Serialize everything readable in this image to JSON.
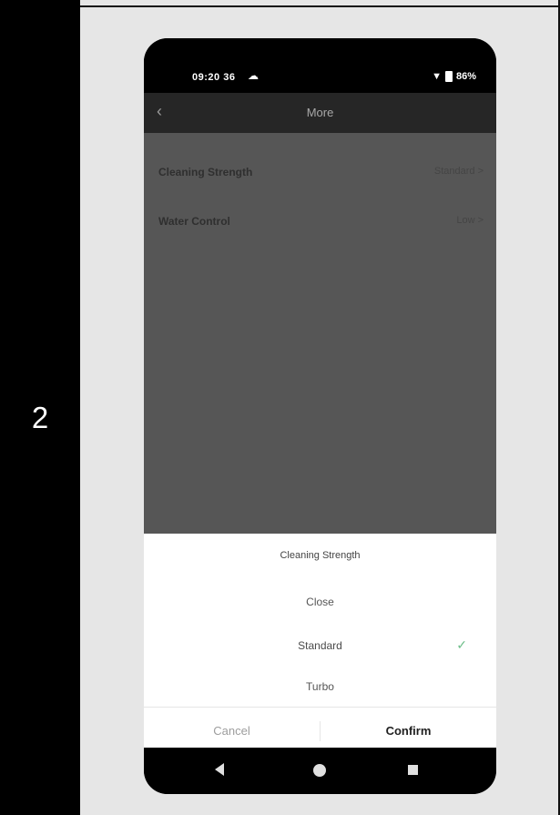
{
  "step": {
    "number": "2"
  },
  "statusbar": {
    "time": "09:20",
    "network_badges": "36",
    "battery": "86%"
  },
  "appbar": {
    "title": "More"
  },
  "settings": {
    "rows": [
      {
        "label": "Cleaning Strength",
        "value": "Standard >"
      },
      {
        "label": "Water Control",
        "value": "Low >"
      }
    ]
  },
  "sheet": {
    "title": "Cleaning Strength",
    "options": [
      {
        "label": "Close",
        "selected": false
      },
      {
        "label": "Standard",
        "selected": true
      },
      {
        "label": "Turbo",
        "selected": false
      }
    ],
    "cancel_label": "Cancel",
    "confirm_label": "Confirm"
  },
  "colors": {
    "check": "#6fbf8b",
    "overlay": "#565656",
    "panel": "#e6e6e6"
  }
}
